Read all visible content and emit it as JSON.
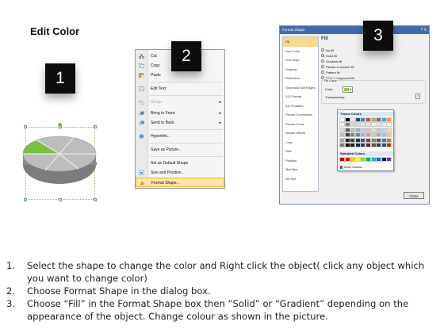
{
  "title": "Edit Color",
  "steps": [
    "1",
    "2",
    "3"
  ],
  "colors": {
    "pie_highlight": "#7ac143",
    "pie_gray_top": "#b8b8b8",
    "pie_gray_side": "#8a8a8a",
    "menu_highlight": "#fde5a5",
    "dialog_titlebar": "#3f6ba8",
    "nav_active": "#f8d98d"
  },
  "context_menu": {
    "items": [
      {
        "label": "Cut",
        "icon": "scissors-icon",
        "disabled": false,
        "submenu": false
      },
      {
        "label": "Copy",
        "icon": "copy-icon",
        "disabled": false,
        "submenu": false
      },
      {
        "label": "Paste",
        "icon": "paste-icon",
        "disabled": false,
        "submenu": false
      },
      {
        "label": "Edit Text",
        "icon": "edit-text-icon",
        "disabled": false,
        "submenu": false
      },
      {
        "label": "Group",
        "icon": "group-icon",
        "disabled": true,
        "submenu": true
      },
      {
        "label": "Bring to Front",
        "icon": "bring-front-icon",
        "disabled": false,
        "submenu": true
      },
      {
        "label": "Send to Back",
        "icon": "send-back-icon",
        "disabled": false,
        "submenu": true
      },
      {
        "label": "Hyperlink...",
        "icon": "hyperlink-icon",
        "disabled": false,
        "submenu": false
      },
      {
        "label": "Save as Picture...",
        "icon": "",
        "disabled": false,
        "submenu": false
      },
      {
        "label": "Set as Default Shape",
        "icon": "",
        "disabled": false,
        "submenu": false
      },
      {
        "label": "Size and Position...",
        "icon": "size-position-icon",
        "disabled": false,
        "submenu": false
      },
      {
        "label": "Format Shape...",
        "icon": "format-shape-icon",
        "disabled": false,
        "submenu": false,
        "highlighted": true
      }
    ]
  },
  "dialog": {
    "title": "Format Shape",
    "window_buttons": "? X",
    "nav": [
      "Fill",
      "Line Color",
      "Line Style",
      "Shadow",
      "Reflection",
      "Glow and Soft Edges",
      "3-D Format",
      "3-D Rotation",
      "Picture Corrections",
      "Picture Color",
      "Artistic Effects",
      "Crop",
      "Size",
      "Position",
      "Text Box",
      "Alt Text"
    ],
    "pane_title": "Fill",
    "options": [
      "No fill",
      "Solid fill",
      "Gradient fill",
      "Picture or texture fill",
      "Pattern fill",
      "Slide background fill"
    ],
    "selected_option": "Solid fill",
    "fill_color_group": "Fill Color",
    "color_label": "Color:",
    "transparency_label": "Transparency:",
    "close_label": "Close"
  },
  "palette": {
    "theme_label": "Theme Colors",
    "standard_label": "Standard Colors",
    "more_label": "More Colors...",
    "theme_top": [
      "#ffffff",
      "#000000",
      "#eeece1",
      "#1f497d",
      "#4f81bd",
      "#c0504d",
      "#9bbb59",
      "#8064a2",
      "#4bacc6",
      "#f79646"
    ],
    "theme_shades": [
      [
        "#f2f2f2",
        "#7f7f7f",
        "#ddd9c3",
        "#c6d9f0",
        "#dbe5f1",
        "#f2dcdb",
        "#ebf1dd",
        "#e5e0ec",
        "#dbeef3",
        "#fdeada"
      ],
      [
        "#d8d8d8",
        "#595959",
        "#c4bd97",
        "#8db3e2",
        "#b8cce4",
        "#e5b9b7",
        "#d7e3bc",
        "#ccc1d9",
        "#b7dde8",
        "#fbd5b5"
      ],
      [
        "#bfbfbf",
        "#3f3f3f",
        "#938953",
        "#548dd4",
        "#95b3d7",
        "#d99694",
        "#c3d69b",
        "#b2a2c7",
        "#92cddc",
        "#fac08f"
      ],
      [
        "#a5a5a5",
        "#262626",
        "#494429",
        "#17365d",
        "#366092",
        "#953734",
        "#76923c",
        "#5f497a",
        "#31859b",
        "#e36c09"
      ],
      [
        "#7f7f7f",
        "#0c0c0c",
        "#1d1b10",
        "#0f243e",
        "#244061",
        "#632423",
        "#4f6128",
        "#3f3151",
        "#205867",
        "#974806"
      ]
    ],
    "standard": [
      "#c00000",
      "#ff0000",
      "#ffc000",
      "#ffff00",
      "#92d050",
      "#00b050",
      "#00b0f0",
      "#0070c0",
      "#002060",
      "#7030a0"
    ]
  },
  "instructions": [
    {
      "num": "1.",
      "text": "Select the shape to change the color and Right click the object( click any object which you want to change color)"
    },
    {
      "num": "2.",
      "text": "Choose Format Shape in the dialog box."
    },
    {
      "num": "3.",
      "text": "Choose “Fill” in the Format Shape box then “Solid” or “Gradient” depending on the appearance of the object. Change colour as shown in the picture."
    }
  ]
}
